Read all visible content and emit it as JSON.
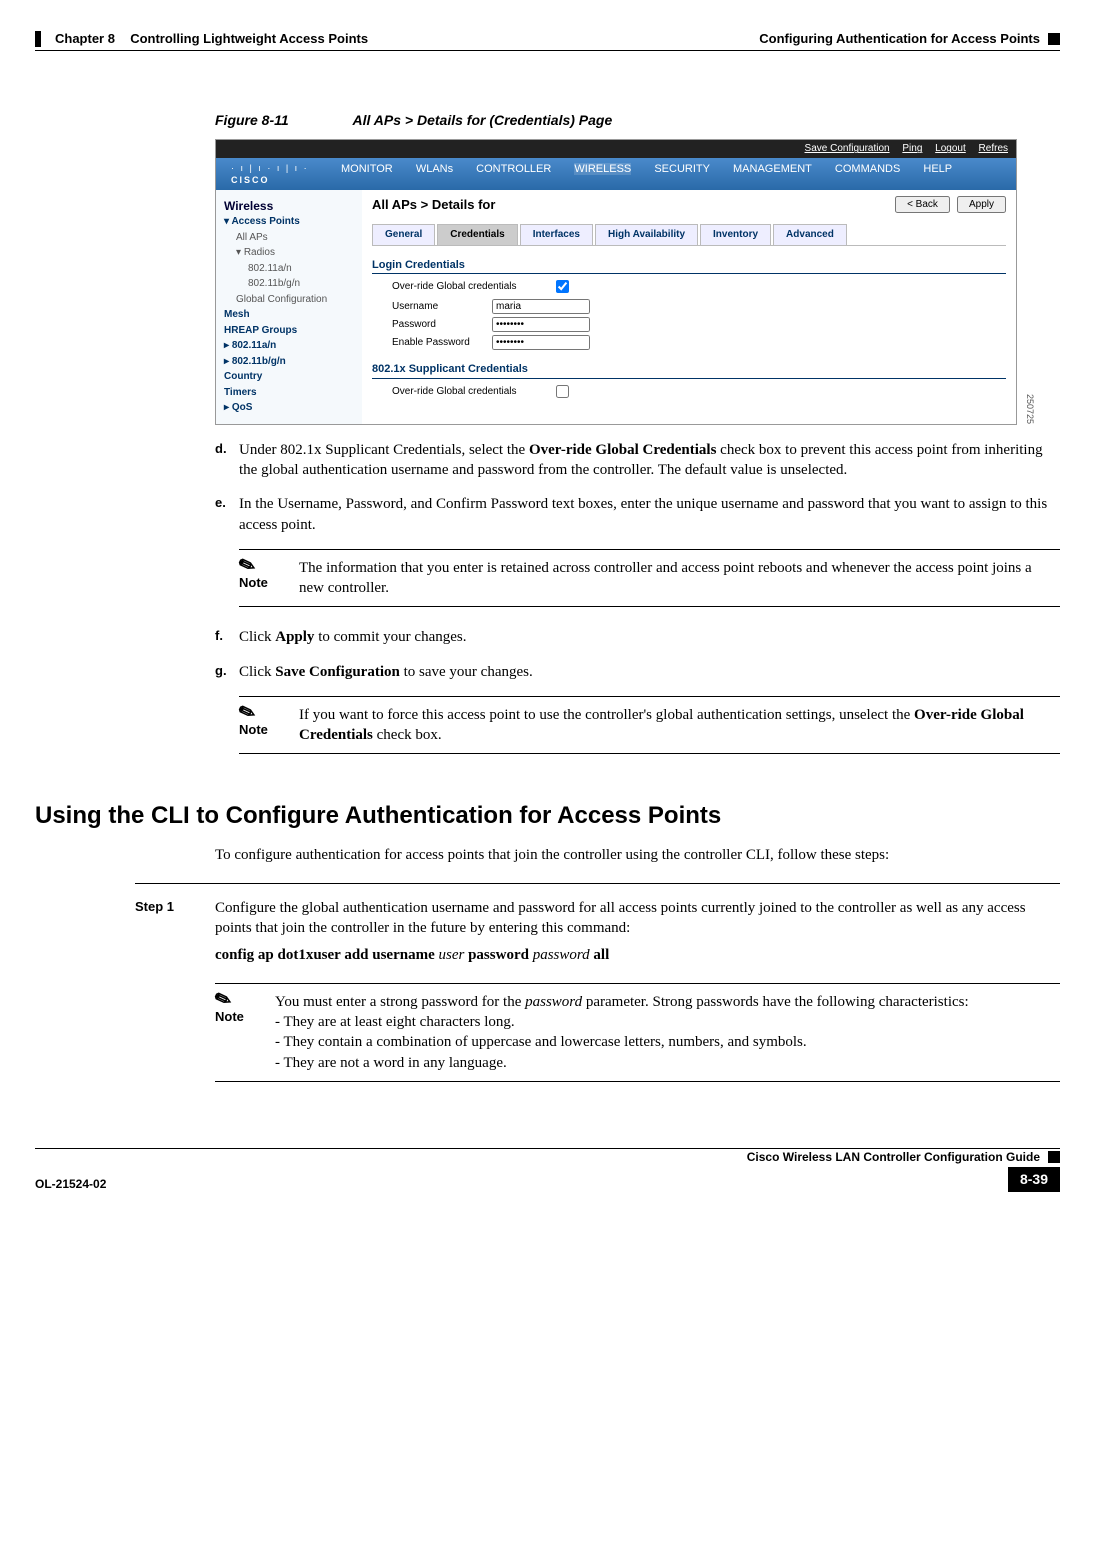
{
  "header": {
    "chapter": "Chapter 8",
    "chapter_title": "Controlling Lightweight Access Points",
    "section": "Configuring Authentication for Access Points"
  },
  "figure": {
    "number": "Figure 8-11",
    "title": "All APs > Details for (Credentials) Page"
  },
  "screenshot": {
    "id": "250725",
    "topbar": {
      "save": "Save Configuration",
      "ping": "Ping",
      "logout": "Logout",
      "refresh": "Refres"
    },
    "logo_top": "· ı | ı · ı | ı ·",
    "logo": "CISCO",
    "menu": [
      "MONITOR",
      "WLANs",
      "CONTROLLER",
      "WIRELESS",
      "SECURITY",
      "MANAGEMENT",
      "COMMANDS",
      "HELP"
    ],
    "sidebar": {
      "title": "Wireless",
      "items": [
        {
          "label": "Access Points",
          "bold": true
        },
        {
          "label": "All APs",
          "sub": true
        },
        {
          "label": "Radios",
          "sub": true
        },
        {
          "label": "802.11a/n",
          "sub2": true
        },
        {
          "label": "802.11b/g/n",
          "sub2": true
        },
        {
          "label": "Global Configuration",
          "sub": true
        },
        {
          "label": "Mesh",
          "bold": true
        },
        {
          "label": "HREAP Groups",
          "bold": true
        },
        {
          "label": "802.11a/n",
          "bold": true,
          "tri": true
        },
        {
          "label": "802.11b/g/n",
          "bold": true,
          "tri": true
        },
        {
          "label": "Country",
          "bold": true
        },
        {
          "label": "Timers",
          "bold": true
        },
        {
          "label": "QoS",
          "bold": true,
          "tri": true
        }
      ]
    },
    "main": {
      "breadcrumb": "All APs > Details for",
      "back": "< Back",
      "apply": "Apply",
      "tabs": [
        "General",
        "Credentials",
        "Interfaces",
        "High Availability",
        "Inventory",
        "Advanced"
      ],
      "active_tab": 1,
      "section1": "Login Credentials",
      "override1_lbl": "Over-ride Global credentials",
      "username_lbl": "Username",
      "username_val": "maria",
      "password_lbl": "Password",
      "password_val": "••••••••",
      "enable_lbl": "Enable Password",
      "enable_val": "••••••••",
      "section2": "802.1x Supplicant Credentials",
      "override2_lbl": "Over-ride Global credentials"
    }
  },
  "steps": {
    "d": {
      "marker": "d.",
      "text_pre": "Under 802.1x Supplicant Credentials, select the ",
      "bold1": "Over-ride Global Credentials",
      "text_post": " check box to prevent this access point from inheriting the global authentication username and password from the controller. The default value is unselected."
    },
    "e": {
      "marker": "e.",
      "text": "In the Username, Password, and Confirm Password text boxes, enter the unique username and password that you want to assign to this access point."
    },
    "note1": {
      "label": "Note",
      "text": "The information that you enter is retained across controller and access point reboots and whenever the access point joins a new controller."
    },
    "f": {
      "marker": "f.",
      "pre": "Click ",
      "bold": "Apply",
      "post": " to commit your changes."
    },
    "g": {
      "marker": "g.",
      "pre": "Click ",
      "bold": "Save Configuration",
      "post": " to save your changes."
    },
    "note2": {
      "label": "Note",
      "pre": "If you want to force this access point to use the controller's global authentication settings, unselect the ",
      "bold": "Over-ride Global Credentials",
      "post": " check box."
    }
  },
  "section2": {
    "title": "Using the CLI to Configure Authentication for Access Points",
    "intro": "To configure authentication for access points that join the controller using the controller CLI, follow these steps:",
    "step1": {
      "label": "Step 1",
      "text": "Configure the global authentication username and password for all access points currently joined to the controller as well as any access points that join the controller in the future by entering this command:",
      "cmd_parts": {
        "p1": "config ap dot1xuser add username ",
        "a1": "user",
        "p2": " password ",
        "a2": "password",
        "p3": " all"
      }
    },
    "note3": {
      "label": "Note",
      "pre": "You must enter a strong password for the ",
      "italic": "password",
      "post": " parameter. Strong passwords have the following characteristics:",
      "line1": "- They are at least eight characters long.",
      "line2": "- They contain a combination of uppercase and lowercase letters, numbers, and symbols.",
      "line3": "- They are not a word in any language."
    }
  },
  "footer": {
    "doc_id": "OL-21524-02",
    "book": "Cisco Wireless LAN Controller Configuration Guide",
    "page": "8-39"
  }
}
